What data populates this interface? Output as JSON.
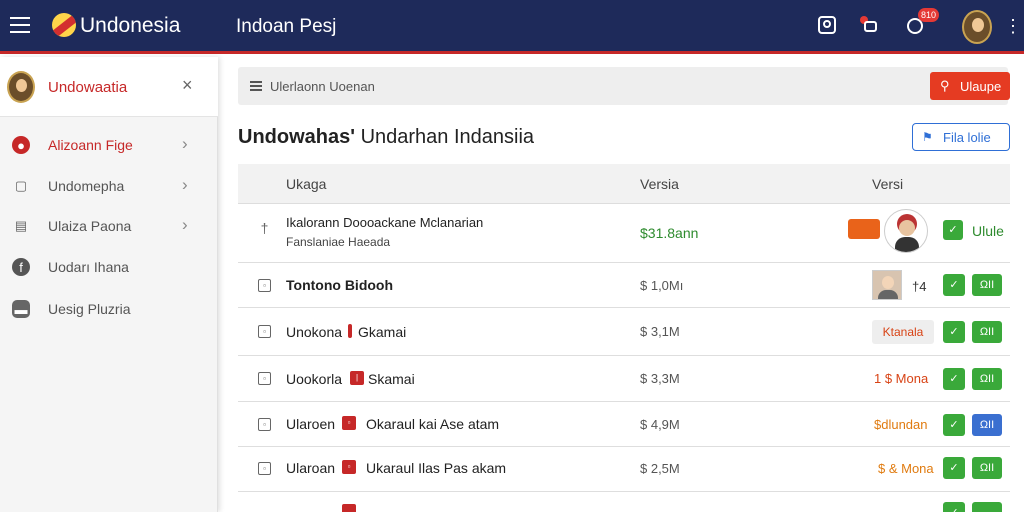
{
  "app": {
    "brand": "Undonesia",
    "page_heading": "Indoan Pesj",
    "notification_count": "810"
  },
  "sidebar": {
    "user_name": "Undowaatia",
    "close_glyph": "×",
    "items": [
      {
        "label": "Alizoann Fige",
        "icon": "record-icon",
        "active": true
      },
      {
        "label": "Undomepha",
        "icon": "square-icon",
        "active": false
      },
      {
        "label": "Ulaiza Paona",
        "icon": "file-icon",
        "active": false
      },
      {
        "label": "Uodarı Ihana",
        "icon": "globe-icon",
        "active": false
      },
      {
        "label": "Uesig Pluzria",
        "icon": "chat-icon",
        "active": false
      }
    ]
  },
  "search": {
    "text": "Ulerlaonn Uoenan",
    "button_label": "Ulaupe"
  },
  "main": {
    "title_bold": "Undowahas",
    "title_rest": "Undarhan Indansiia",
    "filter_label": "Fila lolie"
  },
  "table": {
    "headers": [
      "Ukaga",
      "Versia",
      "Versi"
    ],
    "rows": [
      {
        "icon": "†",
        "name": "Ikalorann Doooackane Mclanarian",
        "sub": "Fanslaniae Haeada",
        "amount": "$31.8ann",
        "status": "",
        "action": "Ulule"
      },
      {
        "icon": "▫",
        "name": "Tontono Bidooh",
        "amount": "$ 1,0Mı",
        "status": "†4",
        "action": "ΩΙΙ"
      },
      {
        "icon": "▫",
        "tag": "|",
        "name": "Unokona",
        "name2": "Gkamai",
        "amount": "$ 3,1M",
        "status": "Ktanala",
        "action": "ΩΙΙ"
      },
      {
        "icon": "▫",
        "tag": "|",
        "name": "Uookorla",
        "name2": "Skamai",
        "amount": "$ 3,3M",
        "status": "1 $ Mona",
        "action": "ΩΙΙ"
      },
      {
        "icon": "▫",
        "tag": "▫",
        "name": "Ularoen",
        "name2": "Okaraul kai Ase atam",
        "amount": "$ 4,9M",
        "status": "$dlundan",
        "action": "ΩΙΙ"
      },
      {
        "icon": "▫",
        "tag": "▫",
        "name": "Ularoan",
        "name2": "Ukaraul Ilas Pas akam",
        "amount": "$ 2,5M",
        "status": "$ & Mona",
        "action": "ΩΙΙ"
      }
    ]
  },
  "colors": {
    "topbar": "#1e2a5a",
    "accent_red": "#c62828",
    "green": "#3aa93a",
    "blue": "#2f6fd6",
    "orange": "#e07b10"
  }
}
